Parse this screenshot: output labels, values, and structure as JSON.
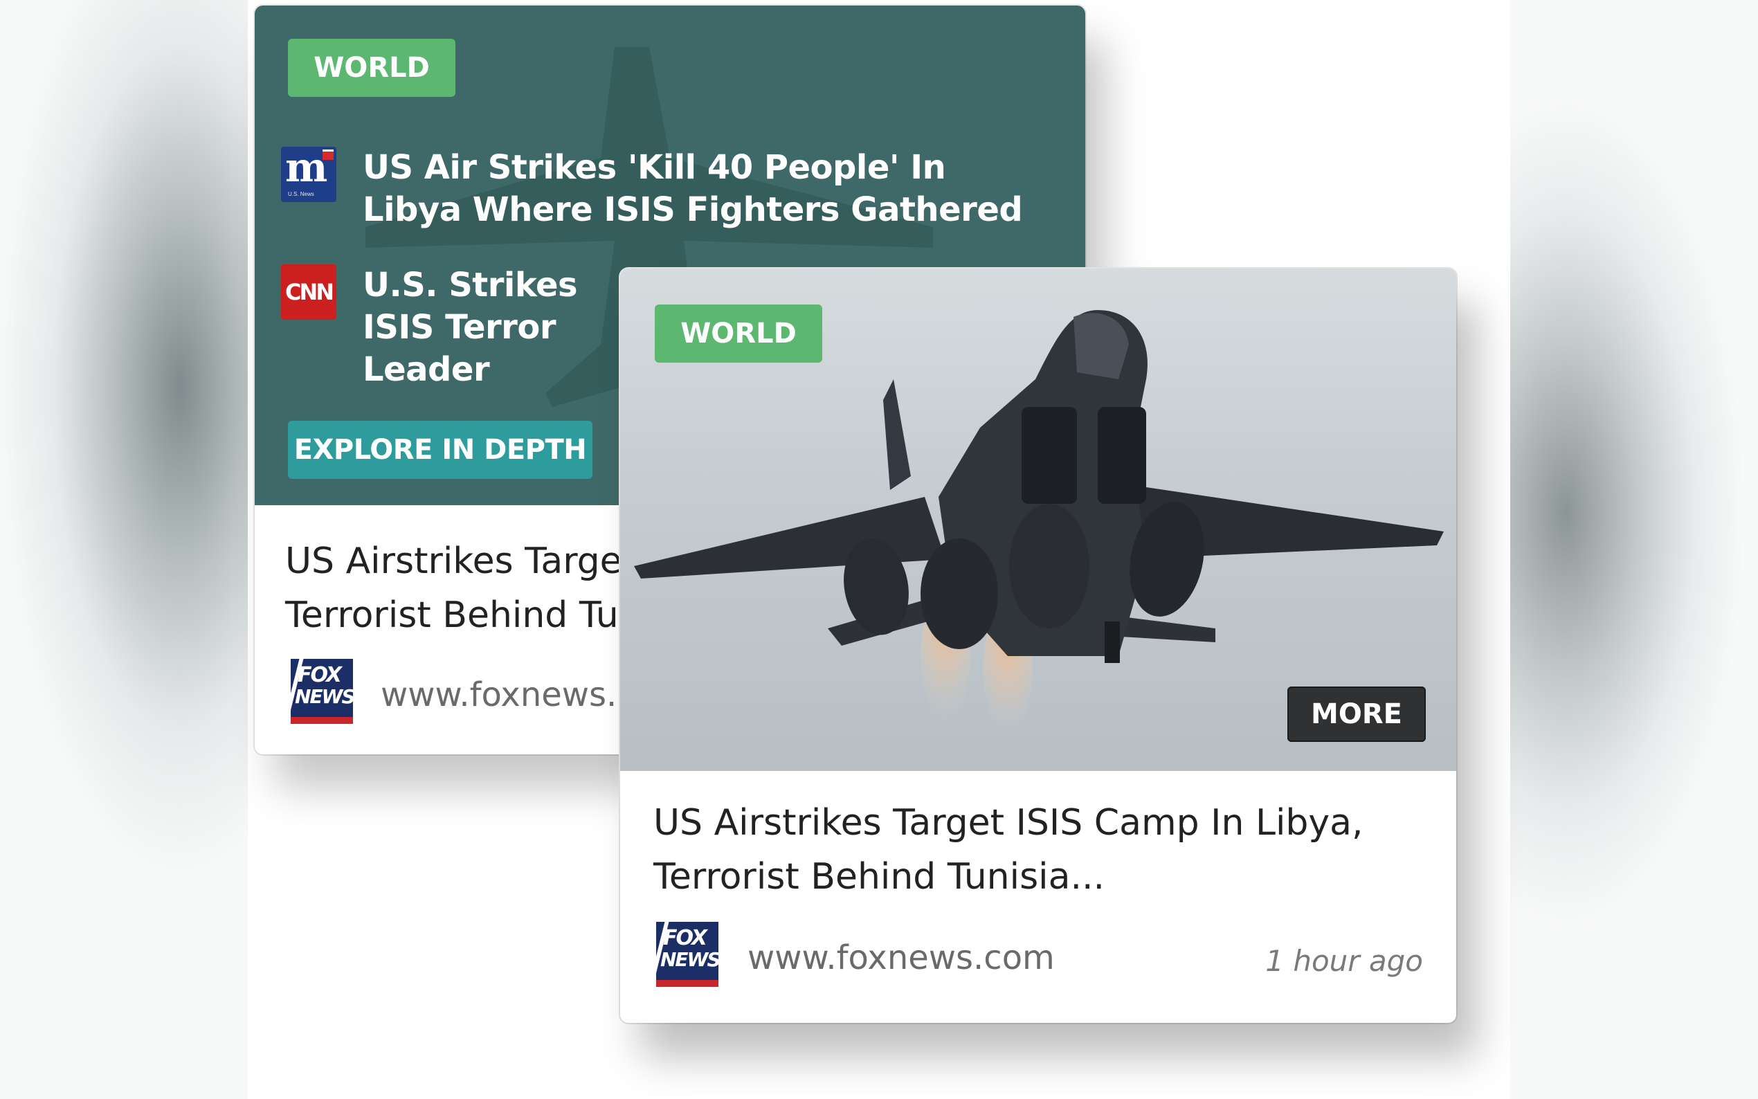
{
  "back_card": {
    "category": "WORLD",
    "related": [
      {
        "source_icon": "mail-online-logo-icon",
        "icon_text": "m",
        "icon_subtext": "U.S. News",
        "headline": "US Air Strikes 'Kill 40 People' In Libya Where ISIS Fighters Gathered"
      },
      {
        "source_icon": "cnn-logo-icon",
        "icon_text": "CNN",
        "headline": "U.S. Strikes ISIS Terror Leader"
      }
    ],
    "explore_label": "EXPLORE IN DEPTH",
    "title": "US Airstrikes Target ISIS Camp In Libya, Terrorist Behind Tunisia...",
    "source_url": "www.foxnews.com"
  },
  "front_card": {
    "category": "WORLD",
    "more_label": "MORE",
    "title": "US Airstrikes Target ISIS Camp In Libya, Terrorist Behind Tunisia...",
    "source_icon": "fox-news-logo-icon",
    "source_url": "www.foxnews.com",
    "time_ago": "1 hour ago"
  },
  "fox_logo": {
    "line1": "FOX",
    "line2": "NEWS"
  },
  "colors": {
    "teal_panel": "#3f6968",
    "world_badge": "#5cb870",
    "explore_button": "#2e9c9c",
    "more_button": "#2f3133",
    "title_text": "#222222",
    "muted_text": "#6a6a6a"
  }
}
